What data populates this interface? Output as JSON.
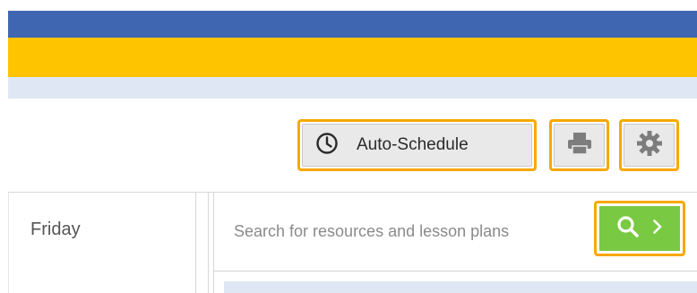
{
  "toolbar": {
    "auto_schedule_label": "Auto-Schedule",
    "auto_schedule_icon": "clock-icon",
    "print_icon": "printer-icon",
    "settings_icon": "gear-icon",
    "highlight_color": "#f7a900"
  },
  "calendar": {
    "day_label": "Friday"
  },
  "search": {
    "placeholder": "Search for resources and lesson plans",
    "value": "",
    "search_icon": "search-icon",
    "go_icon": "chevron-right-icon",
    "button_color": "#7ac943"
  },
  "header": {
    "blue_color": "#3f67b1",
    "yellow_color": "#ffc400",
    "light_color": "#dfe7f5"
  }
}
